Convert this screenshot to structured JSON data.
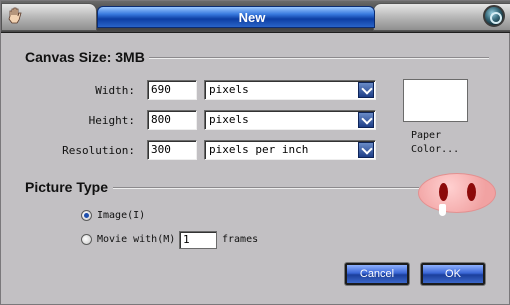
{
  "window": {
    "title": "New"
  },
  "canvas_size": {
    "heading": "Canvas Size: 3MB",
    "width": {
      "label": "Width:",
      "value": "690",
      "unit": "pixels"
    },
    "height": {
      "label": "Height:",
      "value": "800",
      "unit": "pixels"
    },
    "resolution": {
      "label": "Resolution:",
      "value": "300",
      "unit": "pixels per inch"
    },
    "paper_color": {
      "label_line1": "Paper",
      "label_line2": "Color...",
      "color": "#ffffff"
    }
  },
  "picture_type": {
    "heading": "Picture Type",
    "image_option": {
      "label": "Image(I)",
      "selected": true
    },
    "movie_option": {
      "label": "Movie with(M)",
      "selected": false
    },
    "frames_value": "1",
    "frames_label": "frames"
  },
  "buttons": {
    "cancel": "Cancel",
    "ok": "OK"
  },
  "icons": {
    "hand": "hand-icon",
    "close": "close-orb-icon",
    "dropdown": "chevron-down-icon",
    "mascot": "pig-mascot-icon"
  },
  "colors": {
    "accent": "#2a5ec9",
    "dialog_bg": "#c2c0c3"
  }
}
